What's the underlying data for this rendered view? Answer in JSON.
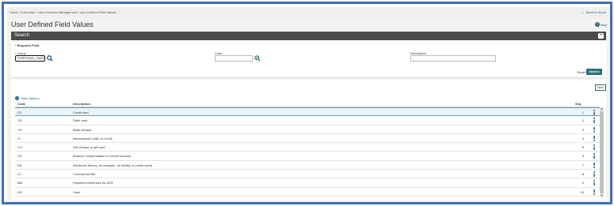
{
  "breadcrumb": "Home / Enterprise / User Interface Management / User Defined Field Values",
  "back_link": "Back to Home",
  "page_title": "User Defined Field Values",
  "help_label": "Help",
  "search": {
    "header": "Search",
    "required_note": "* Required Field",
    "group_label": "* Group",
    "group_value": "PORTUGAL_SAFT",
    "code_label": "Code",
    "code_value": "",
    "description_label": "Description",
    "description_value": "",
    "reset_label": "Reset",
    "search_label": "Search"
  },
  "results": {
    "new_label": "New",
    "view_options_label": "View Options",
    "columns": {
      "code": "Code",
      "description": "Description",
      "seq": "Seq"
    },
    "rows": [
      {
        "code": "CC",
        "description": "Credit card",
        "seq": "1"
      },
      {
        "code": "CD",
        "description": "Debit card",
        "seq": "2"
      },
      {
        "code": "CH",
        "description": "Bank cheque",
        "seq": "3"
      },
      {
        "code": "CI",
        "description": "International Letter of Credit",
        "seq": "4"
      },
      {
        "code": "CO",
        "description": "Gift cheque or gift card",
        "seq": "5"
      },
      {
        "code": "CS",
        "description": "Balance compensation in current account",
        "seq": "6"
      },
      {
        "code": "DE",
        "description": "Electronic Money, for example, on fidelity or points cards",
        "seq": "7"
      },
      {
        "code": "LC",
        "description": "Commercial Bill",
        "seq": "8"
      },
      {
        "code": "MB",
        "description": "Payment references for ATM",
        "seq": "9"
      },
      {
        "code": "NU",
        "description": "Cash",
        "seq": "10"
      }
    ]
  },
  "colors": {
    "accent": "#2e6e6e",
    "header_bar": "#4b4b4b",
    "link": "#1a5c8a",
    "frame": "#3a6fb8"
  }
}
